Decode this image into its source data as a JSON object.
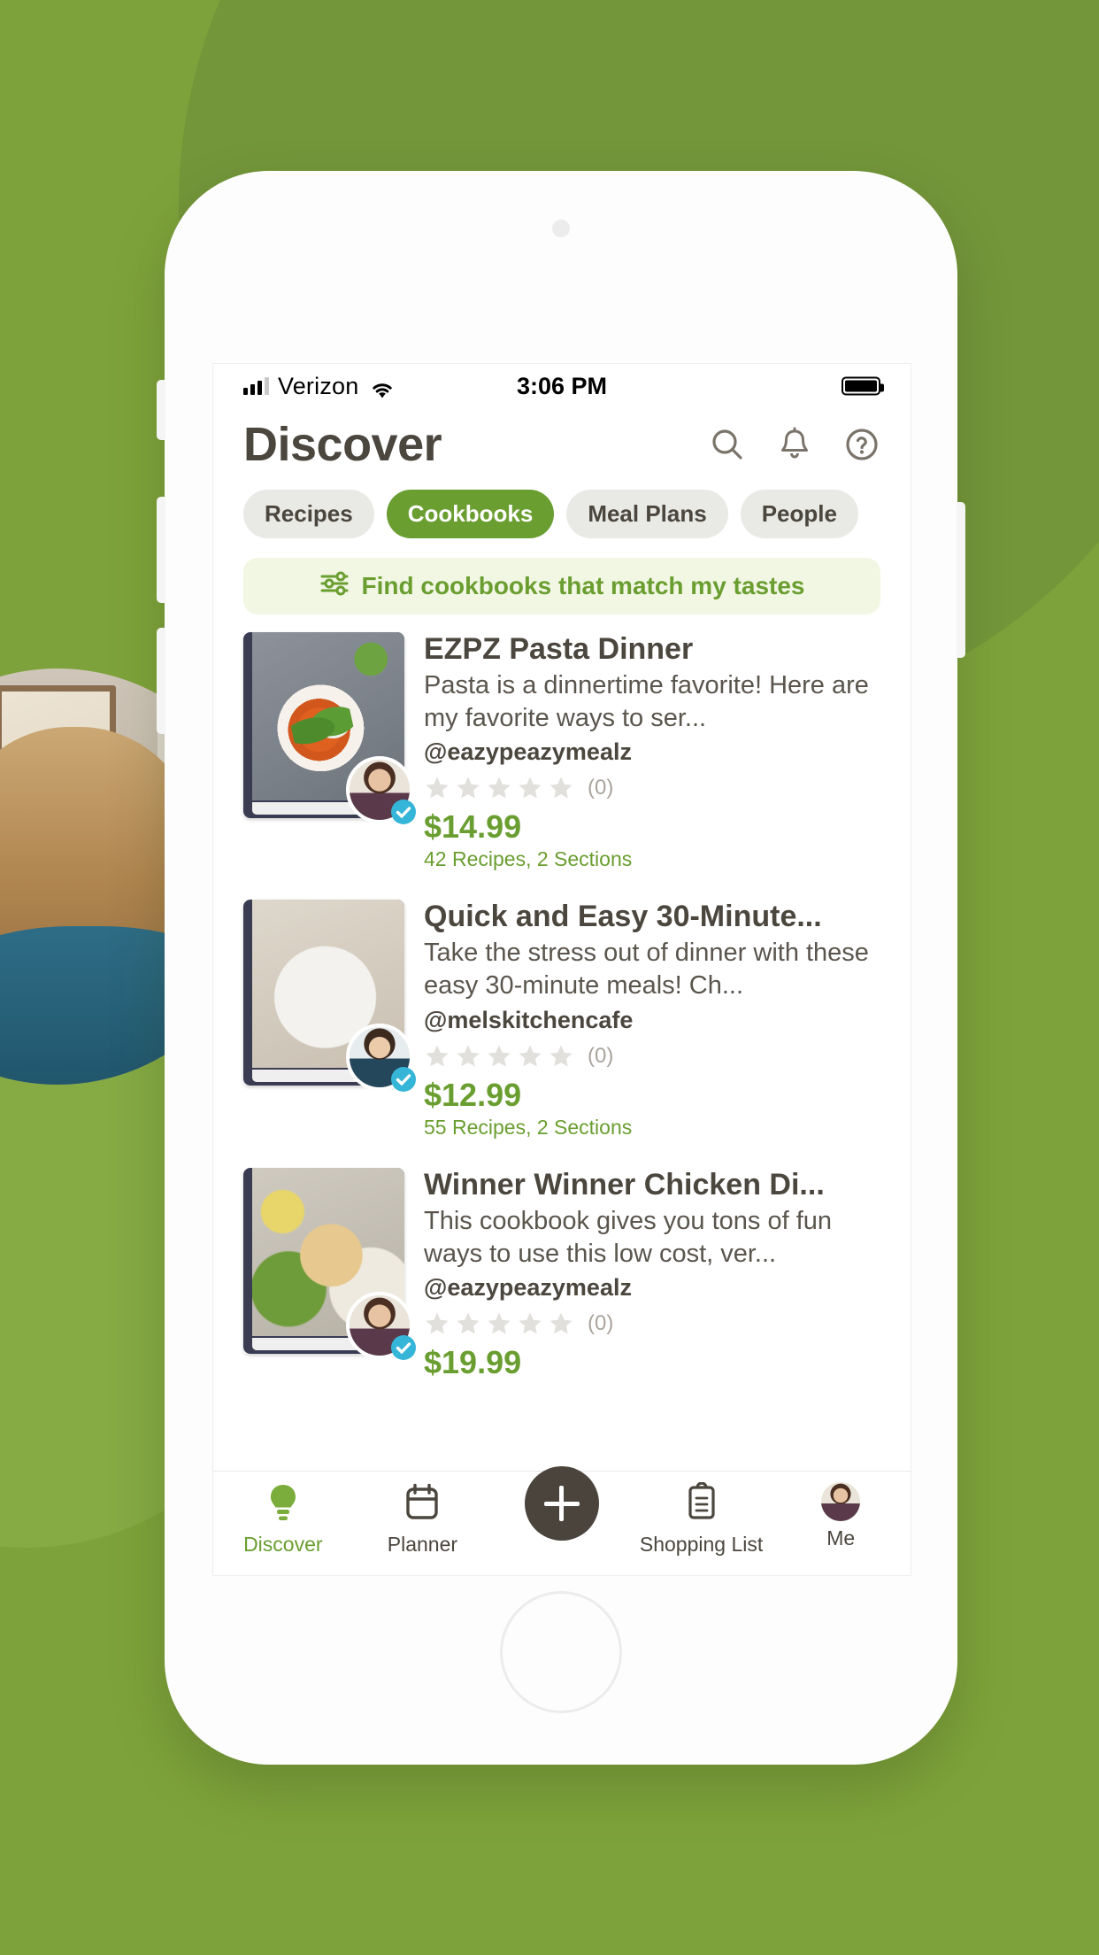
{
  "status_bar": {
    "carrier": "Verizon",
    "time": "3:06 PM",
    "signal_icon": "cellular-bars-icon",
    "wifi_icon": "wifi-icon",
    "battery_icon": "battery-full-icon"
  },
  "header": {
    "title": "Discover",
    "icons": [
      {
        "name": "search-icon",
        "label": "Search"
      },
      {
        "name": "bell-icon",
        "label": "Notifications"
      },
      {
        "name": "help-circle-icon",
        "label": "Help"
      }
    ]
  },
  "tabs": [
    {
      "label": "Recipes",
      "active": false
    },
    {
      "label": "Cookbooks",
      "active": true
    },
    {
      "label": "Meal Plans",
      "active": false
    },
    {
      "label": "People",
      "active": false
    }
  ],
  "filter_banner": {
    "icon": "sliders-icon",
    "label": "Find cookbooks that match my tastes"
  },
  "cookbooks": [
    {
      "title": "EZPZ Pasta Dinner",
      "description": "Pasta is a dinnertime favorite! Here are my favorite ways to ser...",
      "author": "@eazypeazymealz",
      "rating": 0,
      "rating_count": "(0)",
      "price": "$14.99",
      "meta": "42 Recipes, 2 Sections",
      "verified": true
    },
    {
      "title": "Quick and Easy 30-Minute...",
      "description": "Take the stress out of dinner with these easy 30-minute meals! Ch...",
      "author": "@melskitchencafe",
      "rating": 0,
      "rating_count": "(0)",
      "price": "$12.99",
      "meta": "55 Recipes, 2 Sections",
      "verified": true
    },
    {
      "title": "Winner Winner Chicken Di...",
      "description": "This cookbook gives you tons of fun ways to use this low cost, ver...",
      "author": "@eazypeazymealz",
      "rating": 0,
      "rating_count": "(0)",
      "price": "$19.99",
      "meta": "",
      "verified": true
    }
  ],
  "bottom_nav": [
    {
      "label": "Discover",
      "icon": "lightbulb-icon",
      "active": true
    },
    {
      "label": "Planner",
      "icon": "calendar-icon",
      "active": false
    },
    {
      "label": "",
      "icon": "plus-icon",
      "active": false
    },
    {
      "label": "Shopping List",
      "icon": "clipboard-list-icon",
      "active": false
    },
    {
      "label": "Me",
      "icon": "user-avatar-icon",
      "active": false
    }
  ],
  "colors": {
    "brand_green": "#6a9e30",
    "background_green": "#7ea23b",
    "text_dark": "#4b463e",
    "chip_bg": "#e9e9e6",
    "banner_bg": "#f2f7e4",
    "fab_dark": "#4a443d",
    "verified_blue": "#35b5d8"
  }
}
